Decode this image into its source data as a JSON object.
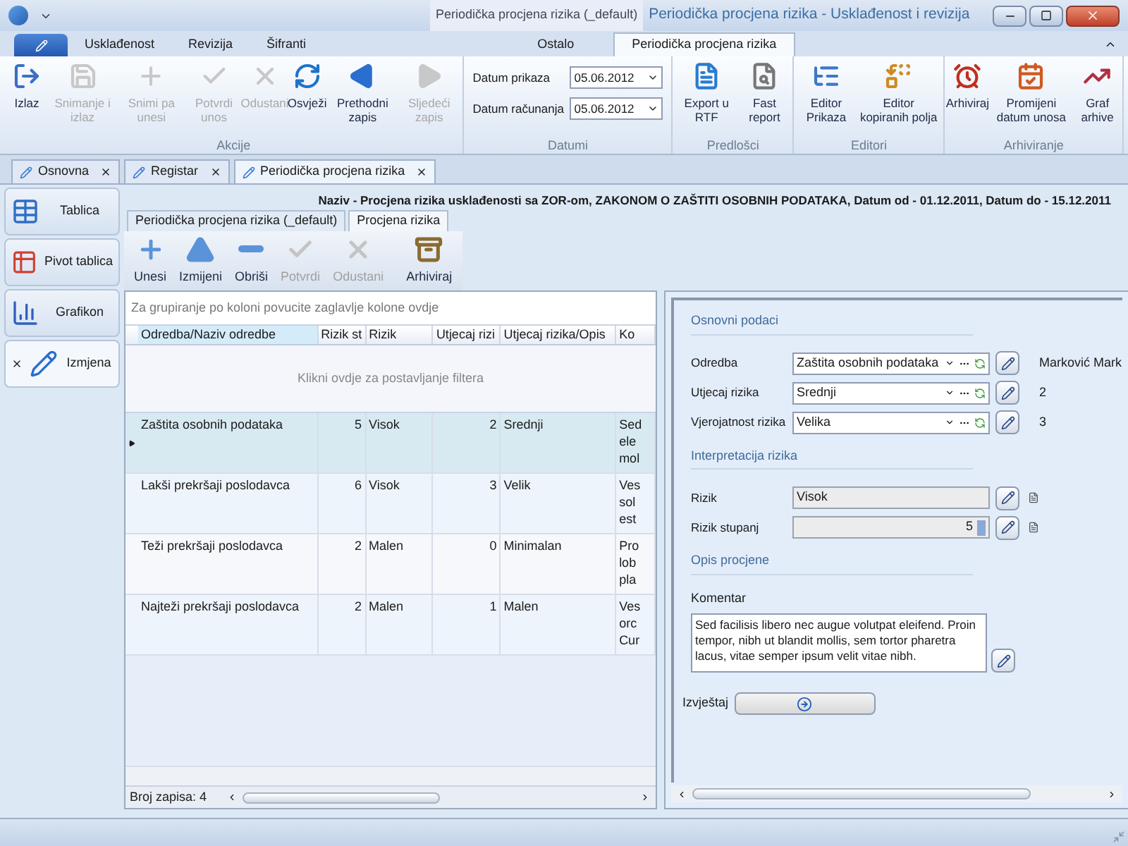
{
  "title_bar": {
    "context_group": "Periodička procjena rizika (_default)",
    "title": "Periodička procjena rizika - Usklađenost i revizija"
  },
  "ribbon": {
    "tabs": [
      {
        "label": "Usklađenost",
        "selected": false
      },
      {
        "label": "Revizija",
        "selected": false
      },
      {
        "label": "Šifranti",
        "selected": false
      },
      {
        "label": "Ostalo",
        "selected": false
      },
      {
        "label": "Periodička procjena rizika",
        "selected": true
      }
    ],
    "groups": [
      {
        "kind": "buttons",
        "label": "Akcije",
        "buttons": [
          {
            "label": "Izlaz",
            "disabled": false
          },
          {
            "label": "Snimanje i izlaz",
            "disabled": true
          },
          {
            "label": "Snimi pa unesi",
            "disabled": true
          },
          {
            "label": "Potvrdi unos",
            "disabled": true
          },
          {
            "label": "Odustani",
            "disabled": true
          },
          {
            "label": "Osvježi",
            "disabled": false
          },
          {
            "label": "Prethodni zapis",
            "disabled": false
          },
          {
            "label": "Sljedeći zapis",
            "disabled": true
          }
        ]
      },
      {
        "kind": "dates",
        "label": "Datumi",
        "fields": [
          {
            "label": "Datum prikaza",
            "value": "05.06.2012"
          },
          {
            "label": "Datum računanja",
            "value": "05.06.2012"
          }
        ]
      },
      {
        "kind": "buttons",
        "label": "Predlošci",
        "buttons": [
          {
            "label": "Export u RTF",
            "disabled": false
          },
          {
            "label": "Fast report",
            "disabled": false
          }
        ]
      },
      {
        "kind": "buttons",
        "label": "Editori",
        "buttons": [
          {
            "label": "Editor Prikaza",
            "disabled": false
          },
          {
            "label": "Editor kopiranih polja",
            "disabled": false
          }
        ]
      },
      {
        "kind": "buttons",
        "label": "Arhiviranje",
        "buttons": [
          {
            "label": "Arhiviraj",
            "disabled": false
          },
          {
            "label": "Promijeni datum unosa",
            "disabled": false
          },
          {
            "label": "Graf arhive",
            "disabled": false
          }
        ]
      }
    ]
  },
  "doc_tabs": [
    {
      "label": "Osnovna",
      "selected": false
    },
    {
      "label": "Registar",
      "selected": false
    },
    {
      "label": "Periodička procjena rizika",
      "selected": true
    }
  ],
  "sidebar": {
    "items": [
      {
        "label": "Tablica",
        "selected": false
      },
      {
        "label": "Pivot tablica",
        "selected": false
      },
      {
        "label": "Grafikon",
        "selected": false
      },
      {
        "label": "Izmjena",
        "selected": true
      }
    ]
  },
  "header": "Naziv - Procjena rizika usklađenosti sa ZOR-om, ZAKONOM O ZAŠTITI OSOBNIH PODATAKA, Datum od - 01.12.2011, Datum do - 15.12.2011",
  "sub_tabs": [
    {
      "label": "Periodička procjena rizika (_default)",
      "selected": false
    },
    {
      "label": "Procjena rizika",
      "selected": true
    }
  ],
  "toolbar": [
    {
      "label": "Unesi",
      "disabled": false
    },
    {
      "label": "Izmijeni",
      "disabled": false
    },
    {
      "label": "Obriši",
      "disabled": false
    },
    {
      "label": "Potvrdi",
      "disabled": true
    },
    {
      "label": "Odustani",
      "disabled": true
    },
    {
      "label": "Arhiviraj",
      "disabled": false
    }
  ],
  "grid": {
    "group_hint": "Za grupiranje po koloni povucite zaglavlje kolone ovdje",
    "columns": [
      "Odredba/Naziv odredbe",
      "Rizik st",
      "Rizik",
      "Utjecaj rizi",
      "Utjecaj rizika/Opis",
      "Ko"
    ],
    "filter_hint": "Klikni ovdje za postavljanje filtera",
    "rows": [
      {
        "selected": true,
        "cells": [
          "Zaštita osobnih podataka",
          "5",
          "Visok",
          "2",
          "Srednji",
          "Sed\nele\nmol"
        ]
      },
      {
        "selected": false,
        "cells": [
          "Lakši prekršaji poslodavca",
          "6",
          "Visok",
          "3",
          "Velik",
          "Ves\nsol\nest"
        ]
      },
      {
        "selected": false,
        "cells": [
          "Teži prekršaji poslodavca",
          "2",
          "Malen",
          "0",
          "Minimalan",
          "Pro\nlob\npla"
        ]
      },
      {
        "selected": false,
        "cells": [
          "Najteži prekršaji poslodavca",
          "2",
          "Malen",
          "1",
          "Malen",
          "Ves\norc\nCur"
        ]
      }
    ],
    "record_count": "Broj zapisa: 4"
  },
  "detail": {
    "sections": [
      {
        "title": "Osnovni podaci",
        "fields": [
          {
            "kind": "combo",
            "label": "Odredba",
            "value": "Zaštita osobnih podataka",
            "extra": "Marković Mark"
          },
          {
            "kind": "combo",
            "label": "Utjecaj rizika",
            "value": "Srednji",
            "extra": "2"
          },
          {
            "kind": "combo",
            "label": "Vjerojatnost rizika",
            "value": "Velika",
            "extra": "3"
          }
        ]
      },
      {
        "title": "Interpretacija rizika",
        "fields": [
          {
            "kind": "readonly",
            "label": "Rizik",
            "value": "Visok"
          },
          {
            "kind": "spin",
            "label": "Rizik stupanj",
            "value": "5"
          }
        ]
      },
      {
        "title": "Opis procjene",
        "fields": [
          {
            "kind": "memo",
            "label": "Komentar",
            "value": "Sed facilisis libero nec augue volutpat eleifend. Proin tempor, nibh ut blandit mollis, sem tortor pharetra lacus, vitae semper ipsum velit vitae nibh."
          }
        ]
      }
    ],
    "report_label": "Izvještaj"
  }
}
